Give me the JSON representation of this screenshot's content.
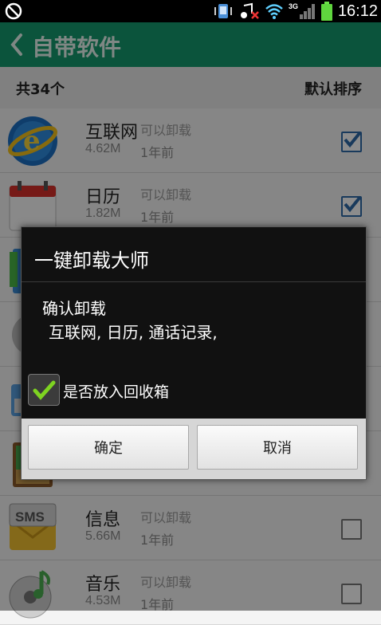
{
  "status_bar": {
    "time": "16:12",
    "network": "3G"
  },
  "header": {
    "title": "自带软件"
  },
  "summary": {
    "count": "共34个",
    "sort": "默认排序"
  },
  "apps": [
    {
      "name": "互联网",
      "tag": "可以卸载",
      "size": "4.62M",
      "time": "1年前",
      "checked": true,
      "icon": "browser-icon"
    },
    {
      "name": "日历",
      "tag": "可以卸载",
      "size": "1.82M",
      "time": "1年前",
      "checked": true,
      "icon": "calendar-icon"
    },
    {
      "name": "",
      "tag": "",
      "size": "",
      "time": "",
      "checked": true,
      "icon": "contacts-icon"
    },
    {
      "name": "",
      "tag": "",
      "size": "",
      "time": "",
      "checked": false,
      "icon": "phone-icon"
    },
    {
      "name": "",
      "tag": "",
      "size": "",
      "time": "",
      "checked": false,
      "icon": "email-icon"
    },
    {
      "name": "",
      "tag": "",
      "size": "",
      "time": "",
      "checked": false,
      "icon": "gallery-icon"
    },
    {
      "name": "信息",
      "tag": "可以卸载",
      "size": "5.66M",
      "time": "1年前",
      "checked": false,
      "icon": "sms-icon"
    },
    {
      "name": "音乐",
      "tag": "可以卸载",
      "size": "4.53M",
      "time": "1年前",
      "checked": false,
      "icon": "music-icon"
    }
  ],
  "dialog": {
    "title": "一键卸载大师",
    "message_line1": "确认卸载",
    "message_line2": "互联网, 日历, 通话记录,",
    "recycle_label": "是否放入回收箱",
    "recycle_checked": true,
    "ok_label": "确定",
    "cancel_label": "取消"
  },
  "colors": {
    "header": "#149a6e",
    "check": "#2f6aa8",
    "dialog_bg": "#111111"
  }
}
